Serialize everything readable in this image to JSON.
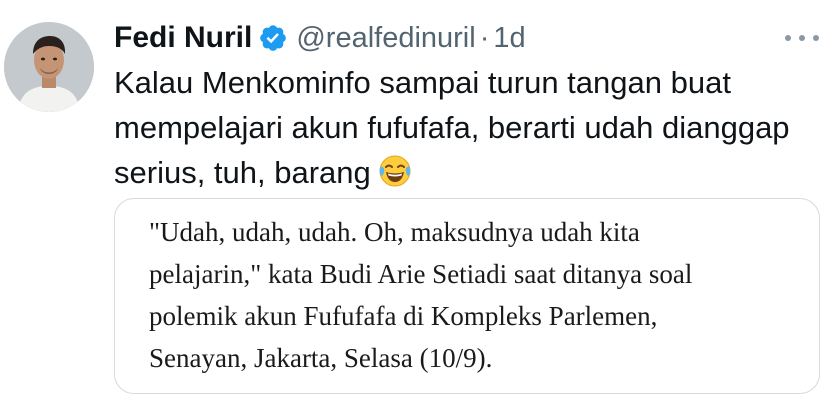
{
  "tweet": {
    "author": {
      "display_name": "Fedi Nuril",
      "handle": "@realfedinuril",
      "verified": true,
      "avatar_icon": "profile-photo"
    },
    "separator": "·",
    "time": "1d",
    "more_icon": "more-horizontal-icon",
    "text_lines": [
      "Kalau Menkominfo sampai turun tangan buat",
      "mempelajari akun fufufafa, berarti udah dianggap",
      "serius, tuh, barang"
    ],
    "emoji": "face-with-tears-of-joy",
    "quote": {
      "lines": [
        "\"Udah, udah, udah. Oh, maksudnya udah kita",
        "pelajarin,\" kata Budi Arie Setiadi saat ditanya soal",
        "polemik akun Fufufafa di Kompleks Parlemen,",
        "Senayan, Jakarta, Selasa (10/9)."
      ]
    }
  },
  "colors": {
    "text_primary": "#0f1419",
    "text_secondary": "#536471",
    "verified_blue": "#1d9bf0",
    "border": "#d5dbe0"
  }
}
